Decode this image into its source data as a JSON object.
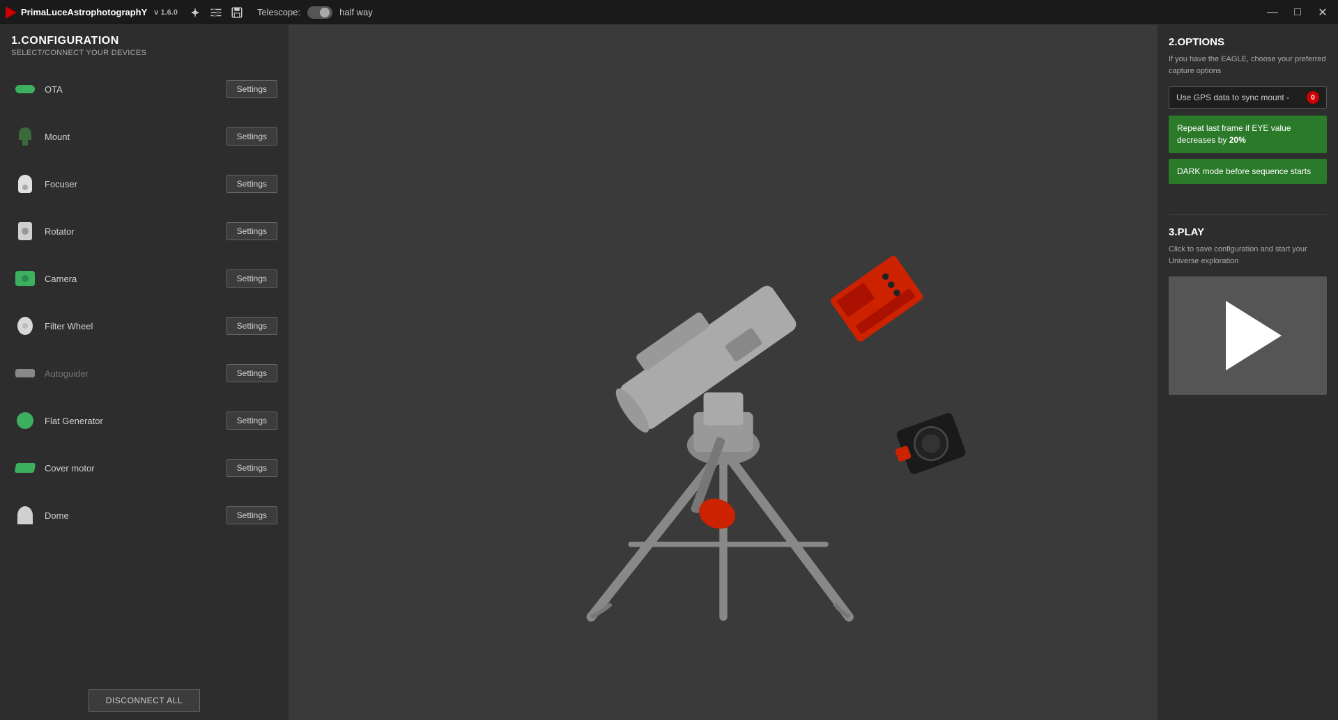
{
  "titlebar": {
    "brand": "PLAY",
    "app_name": "PrimaLuceAstrophotographY",
    "version": "v 1.6.0",
    "telescope_label": "Telescope:",
    "telescope_status": "half way",
    "minimize": "—",
    "maximize": "□",
    "close": "✕"
  },
  "left_panel": {
    "title": "1.CONFIGURATION",
    "subtitle": "SELECT/CONNECT YOUR DEVICES",
    "devices": [
      {
        "id": "ota",
        "name": "OTA",
        "active": true,
        "icon_type": "ota"
      },
      {
        "id": "mount",
        "name": "Mount",
        "active": true,
        "icon_type": "mount"
      },
      {
        "id": "focuser",
        "name": "Focuser",
        "active": true,
        "icon_type": "focuser"
      },
      {
        "id": "rotator",
        "name": "Rotator",
        "active": true,
        "icon_type": "rotator"
      },
      {
        "id": "camera",
        "name": "Camera",
        "active": true,
        "icon_type": "camera"
      },
      {
        "id": "filterwheel",
        "name": "Filter Wheel",
        "active": true,
        "icon_type": "filterwheel"
      },
      {
        "id": "autoguider",
        "name": "Autoguider",
        "active": false,
        "icon_type": "autoguider"
      },
      {
        "id": "flatgenerator",
        "name": "Flat Generator",
        "active": true,
        "icon_type": "flatgenerator"
      },
      {
        "id": "covermotor",
        "name": "Cover motor",
        "active": true,
        "icon_type": "covermotor"
      },
      {
        "id": "dome",
        "name": "Dome",
        "active": true,
        "icon_type": "dome"
      }
    ],
    "settings_label": "Settings",
    "disconnect_all": "DISCONNECT ALL"
  },
  "right_panel": {
    "section2_title": "2.OPTIONS",
    "section2_desc": "If you have the EAGLE, choose your preferred capture options",
    "gps_dropdown_label": "Use GPS data to sync mount -",
    "gps_badge": "0",
    "repeat_frame_btn": "Repeat last frame if EYE value decreases by",
    "repeat_frame_bold": "20%",
    "dark_mode_btn": "DARK mode before sequence starts",
    "section3_title": "3.PLAY",
    "section3_desc": "Click to save configuration and start your Universe exploration"
  }
}
